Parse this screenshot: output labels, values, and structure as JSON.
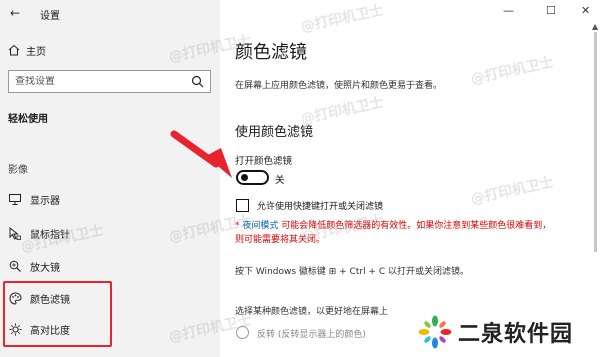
{
  "window": {
    "title": "设置",
    "back_glyph": "←",
    "minimize": "—",
    "maximize": "☐",
    "close": "✕"
  },
  "sidebar": {
    "home_label": "主页",
    "search_placeholder": "查找设置",
    "section_title": "轻松使用",
    "group_label": "影像",
    "items": [
      {
        "label": "显示器",
        "icon": "monitor-icon"
      },
      {
        "label": "鼠标指针",
        "icon": "mouse-pointer-icon"
      },
      {
        "label": "放大镜",
        "icon": "magnifier-icon"
      },
      {
        "label": "颜色滤镜",
        "icon": "palette-icon"
      },
      {
        "label": "高对比度",
        "icon": "contrast-icon"
      }
    ],
    "highlight_color": "#e8232d"
  },
  "main": {
    "title": "颜色滤镜",
    "description": "在屏幕上应用颜色滤镜，使照片和颜色更易于查看。",
    "subtitle": "使用颜色滤镜",
    "toggle_label": "打开颜色滤镜",
    "toggle_state": "关",
    "shortcut_checkbox_label": "允许使用快捷键打开或关闭滤镜",
    "warning_link": "夜间模式",
    "warning_text": "可能会降低颜色筛选器的有效性。如果你注意到某些颜色很难看到，则可能需要将其关闭。",
    "warning_bullet": "*",
    "shortcut_hint": "按下 Windows 徽标键 ⊞ + Ctrl + C 以打开或关闭滤镜。",
    "choose_text": "选择某种颜色滤镜，以更好地在屏幕上",
    "radio_label": "反转",
    "radio_desc": "(反转显示器上的颜色)"
  },
  "watermark": "@打印机卫士",
  "logo": {
    "text": "二泉软件园"
  }
}
